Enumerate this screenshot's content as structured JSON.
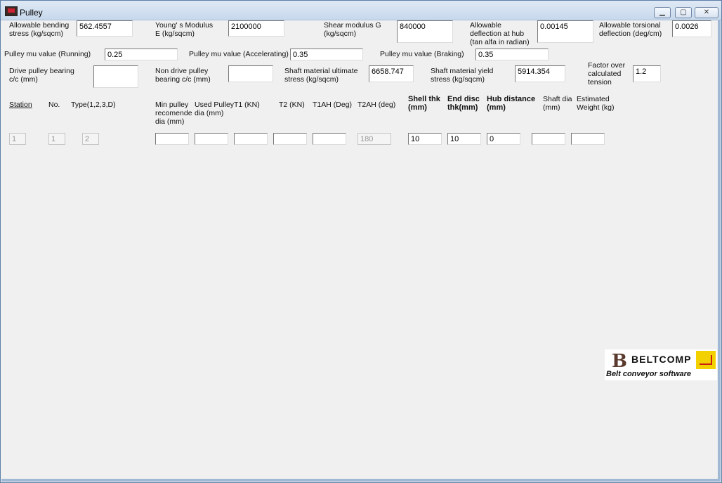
{
  "window": {
    "title": "Pulley",
    "min_label": "▁",
    "max_label": "▢",
    "close_label": "✕"
  },
  "params": {
    "bending_label_1": "Allowable bending",
    "bending_label_2": "stress (kg/sqcm)",
    "bending_value": "562.4557",
    "young_label_1": "Young' s Modulus",
    "young_label_2": "E (kg/sqcm)",
    "young_value": "2100000",
    "shear_label_1": "Shear modulus G",
    "shear_label_2": "(kg/sqcm)",
    "shear_value": "840000",
    "deflection_label_1": "Allowable",
    "deflection_label_2": "deflection at hub",
    "deflection_label_3": "(tan alfa in radian)",
    "deflection_value": "0.00145",
    "torsional_label_1": "Allowable torsional",
    "torsional_label_2": "deflection (deg/cm)",
    "torsional_value": "0.0026",
    "mu_running_label": "Pulley mu value (Running)",
    "mu_running_value": "0.25",
    "mu_accel_label": "Pulley mu value (Accelerating)",
    "mu_accel_value": "0.35",
    "mu_braking_label": "Pulley mu value (Braking)",
    "mu_braking_value": "0.35",
    "drive_label_1": "Drive pulley bearing",
    "drive_label_2": "c/c (mm)",
    "drive_value": "",
    "nondrive_label_1": "Non drive pulley",
    "nondrive_label_2": "bearing c/c (mm)",
    "nondrive_value": "",
    "ultimate_label_1": "Shaft material ultimate",
    "ultimate_label_2": "stress (kg/sqcm)",
    "ultimate_value": "6658.747",
    "yield_label_1": "Shaft material yield",
    "yield_label_2": "stress (kg/sqcm)",
    "yield_value": "5914.354",
    "factor_label_1": "Factor over",
    "factor_label_2": "calculated",
    "factor_label_3": "tension",
    "factor_value": "1.2"
  },
  "table": {
    "headers": {
      "station": "Station",
      "no": "No.",
      "type": "Type(1,2,3,D)",
      "min_1": "Min pulley",
      "min_2": "recomende",
      "min_3": "dia (mm)",
      "used_1": "Used Pulley",
      "used_2": "dia (mm)",
      "t1": "T1 (KN)",
      "t2": "T2 (KN)",
      "t1ah": "T1AH (Deg)",
      "t2ah": "T2AH (deg)",
      "shell_1": "Shell thk",
      "shell_2": "(mm)",
      "enddisc_1": "End disc",
      "enddisc_2": "thk(mm)",
      "hub_1": "Hub distance",
      "hub_2": "(mm)",
      "shaft_1": "Shaft dia",
      "shaft_2": "(mm)",
      "weight_1": "Estimated",
      "weight_2": "Weight (kg)"
    },
    "row": {
      "station": "1",
      "no": "1",
      "type": "2",
      "min_dia": "",
      "used_dia": "",
      "t1": "",
      "t2": "",
      "t1ah": "",
      "t2ah": "180",
      "shell": "10",
      "enddisc": "10",
      "hub": "0",
      "shaft": "",
      "weight": ""
    }
  },
  "logo": {
    "name": "BELTCOMP",
    "tagline": "Belt conveyor software",
    "mark": "B"
  }
}
